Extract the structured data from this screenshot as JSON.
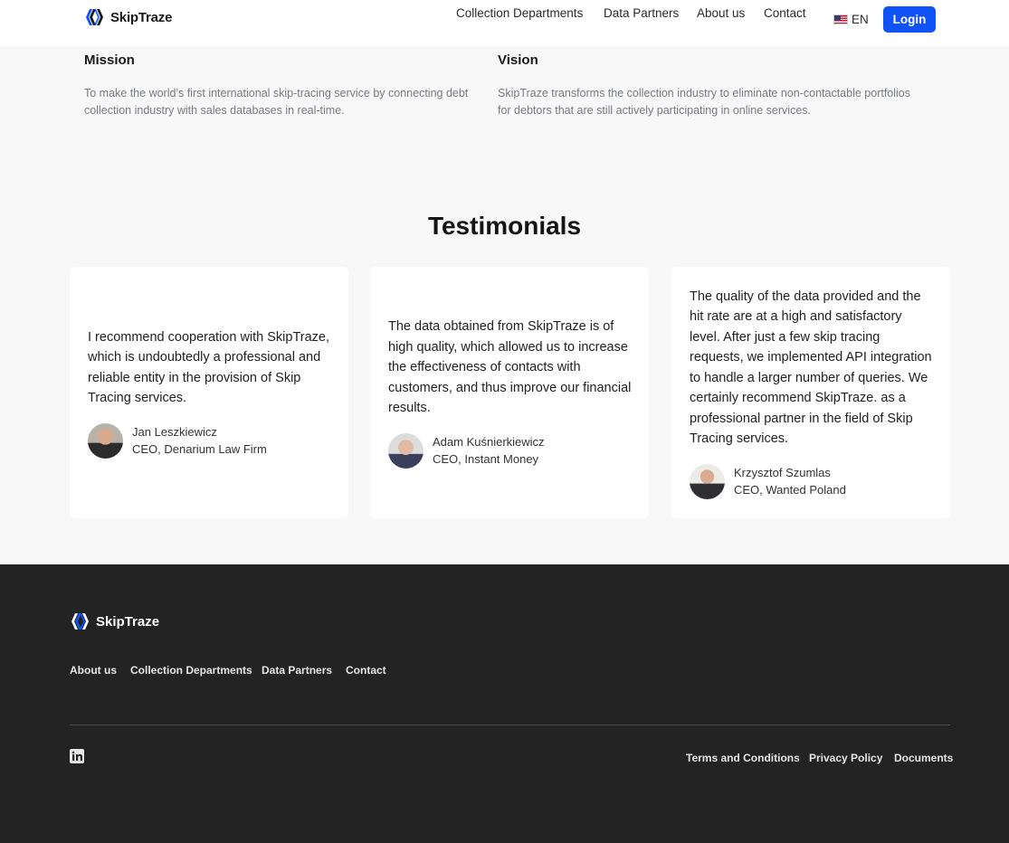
{
  "header": {
    "brand": "SkipTraze",
    "nav": [
      "Collection Departments",
      "Data Partners",
      "About us",
      "Contact"
    ],
    "language": "EN",
    "login_label": "Login"
  },
  "mission": {
    "title": "Mission",
    "text": "To make the world’s first international skip-tracing service by connecting debt collection industry with sales databases in real-time."
  },
  "vision": {
    "title": "Vision",
    "text": "SkipTraze transforms the collection industry to eliminate non-contactable portfolios for debtors that are still actively participating in online services."
  },
  "testimonials": {
    "title": "Testimonials",
    "items": [
      {
        "quote": "I recommend cooperation with SkipTraze, which is undoubtedly a professional and reliable entity in the provision of Skip Tracing services.",
        "name": "Jan Leszkiewicz",
        "role": "CEO, Denarium Law Firm"
      },
      {
        "quote": "The data obtained from SkipTraze is of high quality, which allowed us to increase the effectiveness of contacts with customers, and thus improve our financial results.",
        "name": "Adam Kuśnierkiewicz",
        "role": "CEO, Instant Money"
      },
      {
        "quote": "The quality of the data provided and the hit rate are at a high and satisfactory level. After just a few skip tracing requests, we implemented API integration to handle a larger number of queries. We certainly recommend SkipTraze. as a professional partner in the field of Skip Tracing services.",
        "name": "Krzysztof Szumlas",
        "role": "CEO, Wanted Poland"
      }
    ]
  },
  "footer": {
    "brand": "SkipTraze",
    "nav": [
      "About us",
      "Collection Departments",
      "Data Partners",
      "Contact"
    ],
    "legal": [
      "Terms and Conditions",
      "Privacy Policy",
      "Documents"
    ],
    "social_icon": "linkedin-icon"
  },
  "colors": {
    "accent": "#0f52f5",
    "footer_bg": "#232323",
    "page_bg": "#f8f8f8"
  }
}
